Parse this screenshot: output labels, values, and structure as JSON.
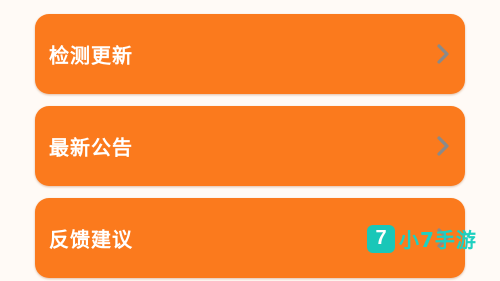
{
  "menu": {
    "items": [
      {
        "label": "检测更新",
        "chevron_icon": "chevron-right-icon"
      },
      {
        "label": "最新公告",
        "chevron_icon": "chevron-right-icon"
      },
      {
        "label": "反馈建议",
        "chevron_icon": "chevron-right-icon"
      }
    ]
  },
  "watermark": {
    "logo_text": "7",
    "brand_text": "小7手游"
  },
  "colors": {
    "item_background": "#fb7a1d",
    "label_text": "#ffffff",
    "chevron": "#8a8a8a",
    "page_background": "#fffaf6",
    "watermark_accent": "#19c7b8"
  }
}
